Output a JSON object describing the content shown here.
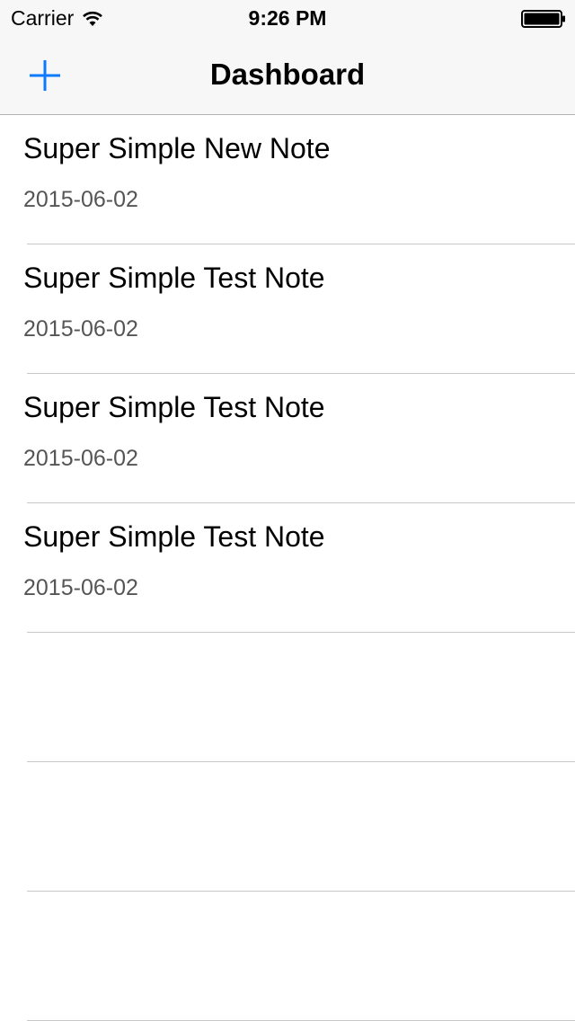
{
  "status_bar": {
    "carrier": "Carrier",
    "time": "9:26 PM",
    "wifi_icon": "wifi-icon",
    "battery_icon": "battery-full-icon"
  },
  "nav_bar": {
    "title": "Dashboard",
    "add_icon": "plus-icon",
    "accent_color": "#0a7aff"
  },
  "notes": [
    {
      "title": "Super Simple New Note",
      "date": "2015-06-02"
    },
    {
      "title": "Super Simple Test Note",
      "date": "2015-06-02"
    },
    {
      "title": "Super Simple Test Note",
      "date": "2015-06-02"
    },
    {
      "title": "Super Simple Test Note",
      "date": "2015-06-02"
    }
  ],
  "colors": {
    "nav_background": "#f7f7f7",
    "separator": "#c8c7cc",
    "subtitle_text": "#555555"
  }
}
